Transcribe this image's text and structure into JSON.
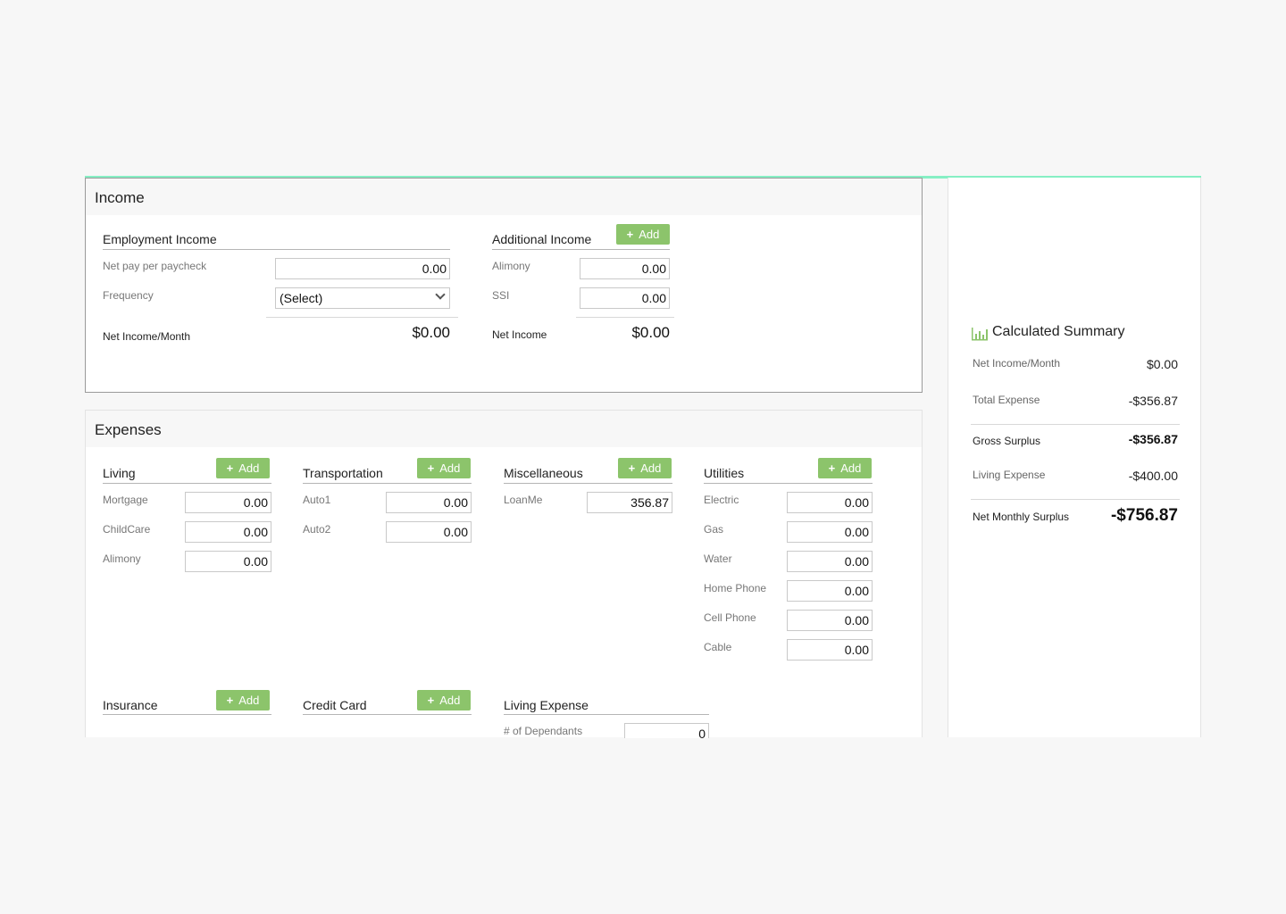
{
  "income": {
    "title": "Income",
    "employment": {
      "title": "Employment Income",
      "net_pay_label": "Net pay per paycheck",
      "net_pay_value": "0.00",
      "frequency_label": "Frequency",
      "frequency_value": "(Select)",
      "net_month_label": "Net Income/Month",
      "net_month_value": "$0.00"
    },
    "additional": {
      "title": "Additional Income",
      "add_label": "Add",
      "rows": [
        {
          "label": "Alimony",
          "value": "0.00"
        },
        {
          "label": "SSI",
          "value": "0.00"
        }
      ],
      "net_label": "Net Income",
      "net_value": "$0.00"
    }
  },
  "expenses": {
    "title": "Expenses",
    "add_label": "Add",
    "living": {
      "title": "Living",
      "rows": [
        {
          "label": "Mortgage",
          "value": "0.00"
        },
        {
          "label": "ChildCare",
          "value": "0.00"
        },
        {
          "label": "Alimony",
          "value": "0.00"
        }
      ]
    },
    "transportation": {
      "title": "Transportation",
      "rows": [
        {
          "label": "Auto1",
          "value": "0.00"
        },
        {
          "label": "Auto2",
          "value": "0.00"
        }
      ]
    },
    "miscellaneous": {
      "title": "Miscellaneous",
      "rows": [
        {
          "label": "LoanMe",
          "value": "356.87"
        }
      ]
    },
    "utilities": {
      "title": "Utilities",
      "rows": [
        {
          "label": "Electric",
          "value": "0.00"
        },
        {
          "label": "Gas",
          "value": "0.00"
        },
        {
          "label": "Water",
          "value": "0.00"
        },
        {
          "label": "Home Phone",
          "value": "0.00"
        },
        {
          "label": "Cell Phone",
          "value": "0.00"
        },
        {
          "label": "Cable",
          "value": "0.00"
        }
      ]
    },
    "insurance": {
      "title": "Insurance"
    },
    "credit_card": {
      "title": "Credit Card"
    },
    "living_expense": {
      "title": "Living Expense",
      "dependants_label": "# of Dependants",
      "dependants_value": "0"
    }
  },
  "summary": {
    "title": "Calculated Summary",
    "icon": "bar-chart-icon",
    "accent_color": "#8cc46b",
    "rows": {
      "net_income_label": "Net Income/Month",
      "net_income_value": "$0.00",
      "total_expense_label": "Total Expense",
      "total_expense_value": "-$356.87",
      "gross_surplus_label": "Gross Surplus",
      "gross_surplus_value": "-$356.87",
      "living_expense_label": "Living Expense",
      "living_expense_value": "-$400.00",
      "net_monthly_label": "Net Monthly Surplus",
      "net_monthly_value": "-$756.87"
    }
  }
}
